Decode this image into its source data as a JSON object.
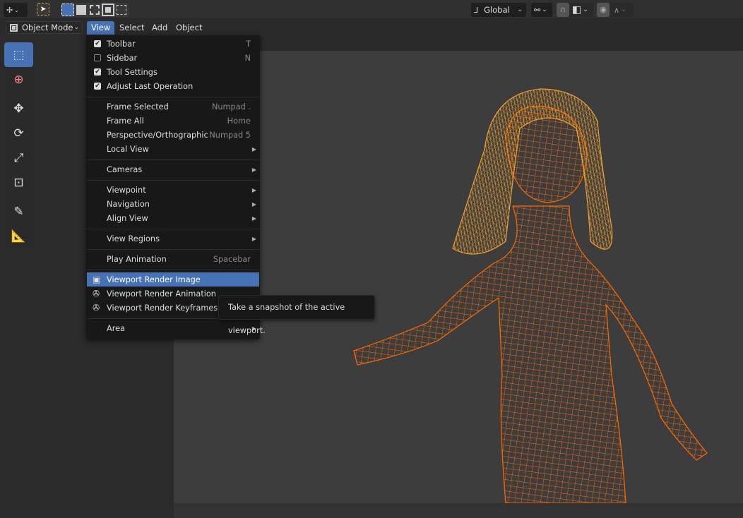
{
  "header": {
    "mode": "Object Mode",
    "menus": [
      "View",
      "Select",
      "Add",
      "Object"
    ],
    "transform_orientation": "Global"
  },
  "menu": {
    "items": [
      {
        "label": "Toolbar",
        "shortcut": "T",
        "check": true
      },
      {
        "label": "Sidebar",
        "shortcut": "N",
        "check": false
      },
      {
        "label": "Tool Settings",
        "shortcut": "",
        "check": true
      },
      {
        "label": "Adjust Last Operation",
        "shortcut": "",
        "check": true
      },
      {
        "label": "Frame Selected",
        "shortcut": "Numpad ."
      },
      {
        "label": "Frame All",
        "shortcut": "Home"
      },
      {
        "label": "Perspective/Orthographic",
        "shortcut": "Numpad 5"
      },
      {
        "label": "Local View",
        "submenu": true
      },
      {
        "label": "Cameras",
        "submenu": true
      },
      {
        "label": "Viewpoint",
        "submenu": true
      },
      {
        "label": "Navigation",
        "submenu": true
      },
      {
        "label": "Align View",
        "submenu": true
      },
      {
        "label": "View Regions",
        "submenu": true
      },
      {
        "label": "Play Animation",
        "shortcut": "Spacebar"
      },
      {
        "label": "Viewport Render Image",
        "icon": "render-image-icon",
        "highlighted": true
      },
      {
        "label": "Viewport Render Animation",
        "icon": "render-animation-icon"
      },
      {
        "label": "Viewport Render Keyframes",
        "icon": "render-animation-icon"
      },
      {
        "label": "Area",
        "submenu": true
      }
    ]
  },
  "tooltip": "Take a snapshot of the active viewport.",
  "colors": {
    "accent": "#4772b3",
    "wireframe": "#ff6a00",
    "hair": "#f0a030"
  }
}
